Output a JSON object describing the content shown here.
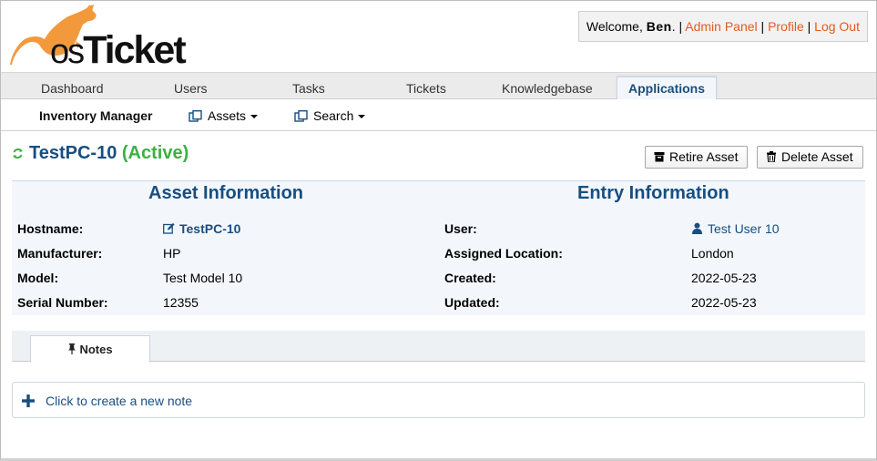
{
  "header": {
    "logo_text_os": "os",
    "logo_text_ticket": "Ticket",
    "welcome_prefix": "Welcome, ",
    "user_name": "Ben",
    "welcome_suffix": ".",
    "separator": "|",
    "links": {
      "admin_panel": "Admin Panel",
      "profile": "Profile",
      "logout": "Log Out"
    },
    "link_color": "#e45b20"
  },
  "nav": {
    "tabs": [
      {
        "label": "Dashboard"
      },
      {
        "label": "Users"
      },
      {
        "label": "Tasks"
      },
      {
        "label": "Tickets"
      },
      {
        "label": "Knowledgebase"
      },
      {
        "label": "Applications",
        "active": true
      }
    ]
  },
  "subnav": {
    "title": "Inventory Manager",
    "assets_label": "Assets",
    "search_label": "Search"
  },
  "asset": {
    "name": "TestPC-10",
    "status": "(Active)",
    "status_color": "#3cb043",
    "retire_label": "Retire Asset",
    "delete_label": "Delete Asset"
  },
  "asset_info": {
    "heading": "Asset Information",
    "hostname_label": "Hostname:",
    "hostname_value": "TestPC-10",
    "manufacturer_label": "Manufacturer:",
    "manufacturer_value": "HP",
    "model_label": "Model:",
    "model_value": "Test Model 10",
    "serial_label": "Serial Number:",
    "serial_value": "12355"
  },
  "entry_info": {
    "heading": "Entry Information",
    "user_label": "User:",
    "user_value": "Test User 10",
    "location_label": "Assigned Location:",
    "location_value": "London",
    "created_label": "Created:",
    "created_value": "2022-05-23",
    "updated_label": "Updated:",
    "updated_value": "2022-05-23"
  },
  "tabs": {
    "notes_label": "Notes"
  },
  "notes": {
    "create_label": "Click to create a new note"
  },
  "colors": {
    "primary_blue": "#184e81",
    "logo_orange": "#f29a3b"
  }
}
